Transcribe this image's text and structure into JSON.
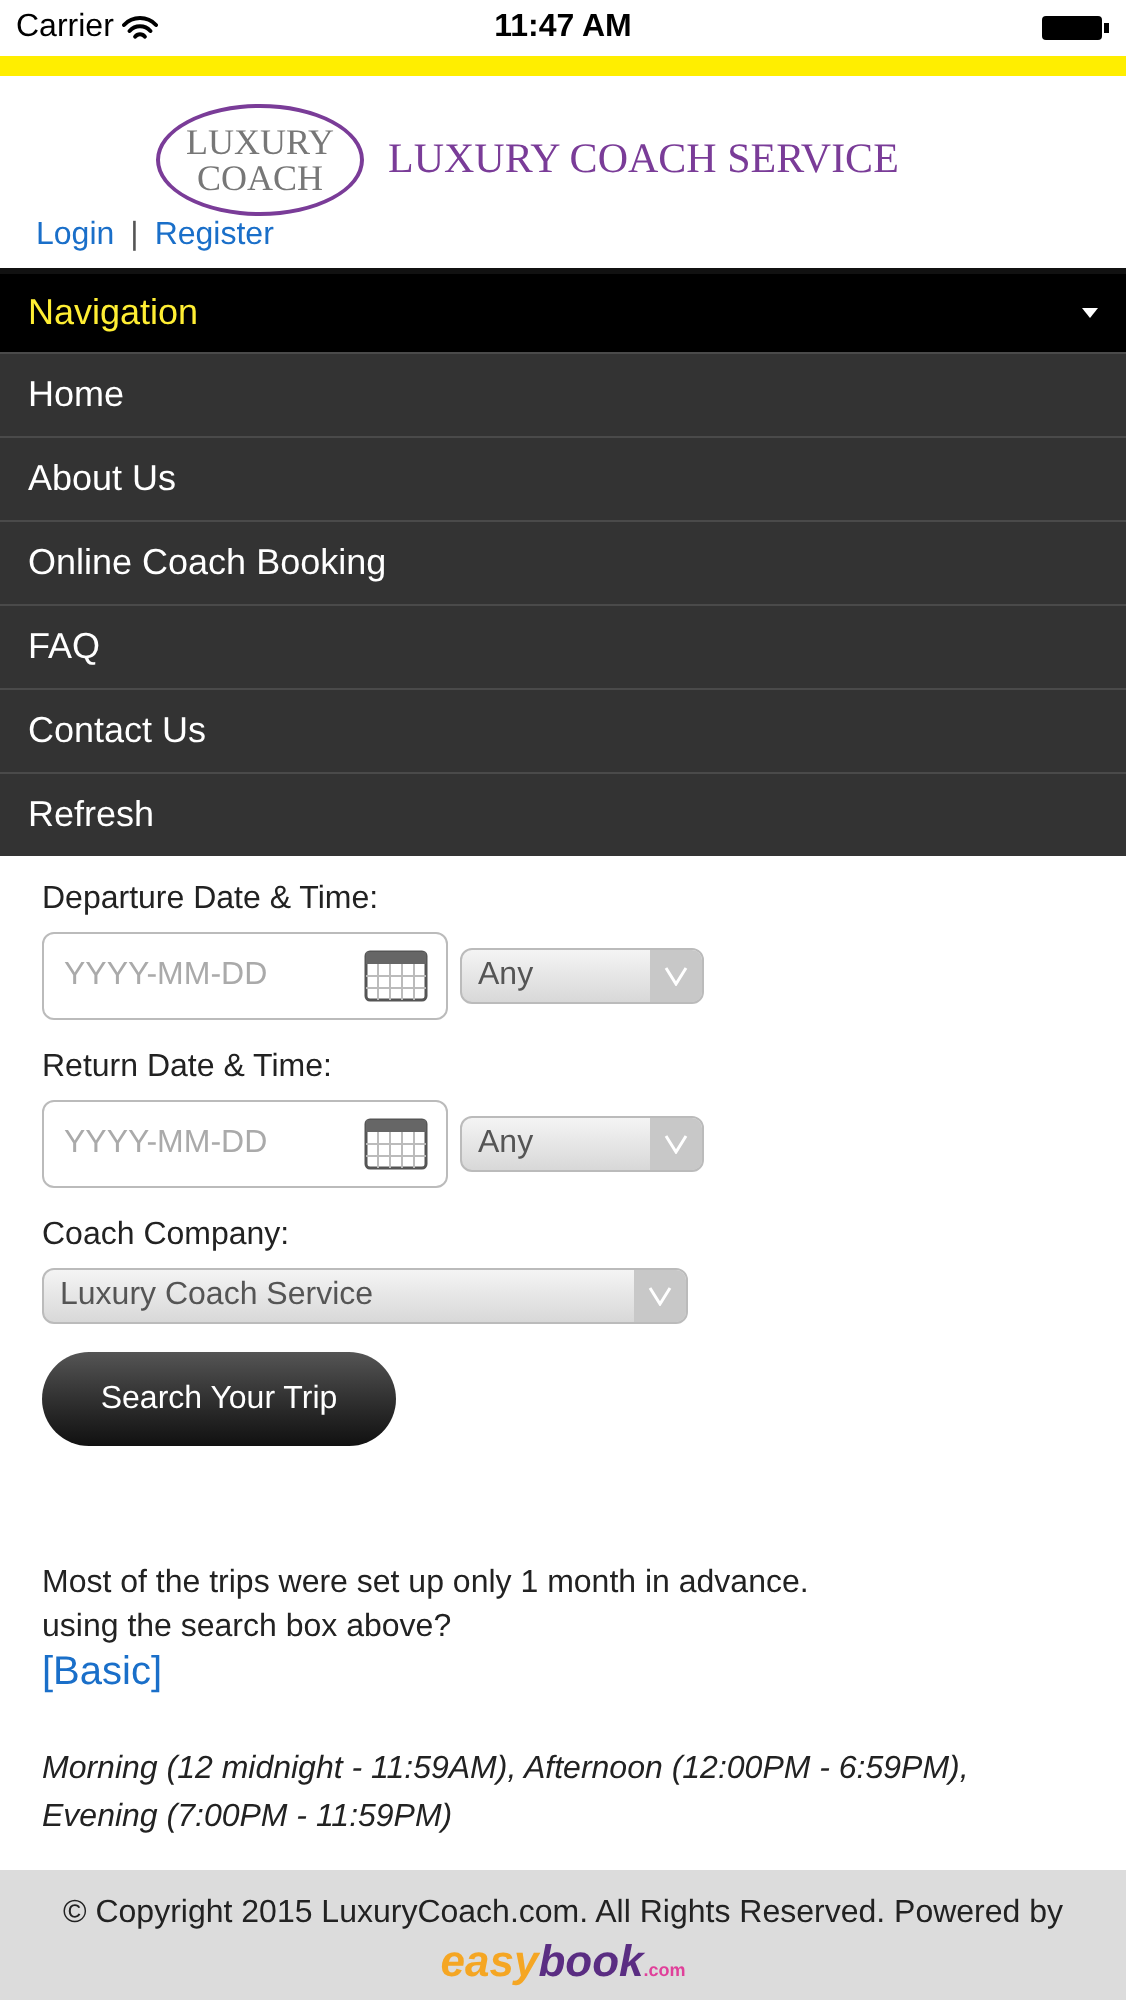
{
  "status_bar": {
    "carrier": "Carrier",
    "time": "11:47 AM"
  },
  "header": {
    "logo_lines": [
      "LUXURY",
      "COACH"
    ],
    "site_title": "LUXURY COACH SERVICE",
    "links": [
      {
        "label": "Login"
      },
      {
        "label": "Register"
      }
    ],
    "separator": "|"
  },
  "navigation": {
    "title": "Navigation",
    "expanded": true,
    "items": [
      {
        "label": "Home"
      },
      {
        "label": "About Us"
      },
      {
        "label": "Online Coach Booking"
      },
      {
        "label": "FAQ"
      },
      {
        "label": "Contact Us"
      },
      {
        "label": "Refresh"
      }
    ]
  },
  "form": {
    "fields": [
      {
        "kind": "datetime",
        "label": "Departure Date & Time:",
        "placeholder": "YYYY-MM-DD",
        "time": "Any"
      },
      {
        "kind": "datetime",
        "label": "Return Date & Time:",
        "placeholder": "YYYY-MM-DD",
        "time": "Any"
      },
      {
        "kind": "select",
        "label": "Coach Company:",
        "value": "Luxury Coach Service"
      }
    ],
    "submit": "Search Your Trip"
  },
  "note": {
    "lines": [
      "Most of the trips were set up only 1 month in advance.",
      "using the search box above?"
    ],
    "link": "[Basic]"
  },
  "time_ranges": "Morning (12 midnight - 11:59AM), Afternoon (12:00PM - 6:59PM), Evening (7:00PM - 11:59PM)",
  "footer": {
    "copyright": "© Copyright 2015 LuxuryCoach.com. All Rights Reserved. Powered by",
    "brand": [
      "easy",
      "book",
      ".com"
    ]
  }
}
